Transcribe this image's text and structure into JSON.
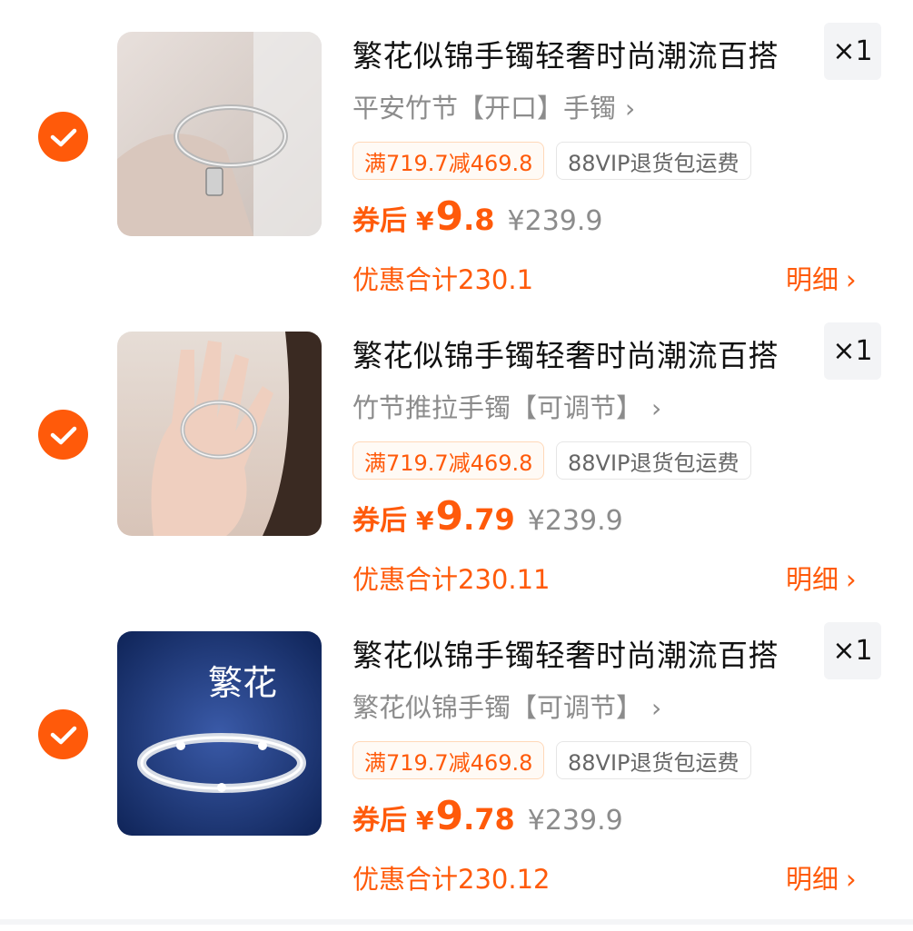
{
  "colors": {
    "accent": "#ff5a0a",
    "muted": "#8c8c8c",
    "text": "#111111"
  },
  "items": [
    {
      "title": "繁花似锦手镯轻奢时尚潮流百搭",
      "qty": "×1",
      "spec": "平安竹节【开口】手镯",
      "promo_tag": "满719.7减469.8",
      "vip_tag": "88VIP退货包运费",
      "after_label": "券后",
      "yen": "¥",
      "price_int": "9",
      "price_dec": ".8",
      "orig_price": "¥239.9",
      "discount": "优惠合计230.1",
      "detail": "明细",
      "image_icon": "bracelet-pendant-photo"
    },
    {
      "title": "繁花似锦手镯轻奢时尚潮流百搭",
      "qty": "×1",
      "spec": "竹节推拉手镯【可调节】",
      "promo_tag": "满719.7减469.8",
      "vip_tag": "88VIP退货包运费",
      "after_label": "券后",
      "yen": "¥",
      "price_int": "9",
      "price_dec": ".79",
      "orig_price": "¥239.9",
      "discount": "优惠合计230.11",
      "detail": "明细",
      "image_icon": "bracelet-hand-photo"
    },
    {
      "title": "繁花似锦手镯轻奢时尚潮流百搭",
      "qty": "×1",
      "spec": "繁花似锦手镯【可调节】",
      "promo_tag": "满719.7减469.8",
      "vip_tag": "88VIP退货包运费",
      "after_label": "券后",
      "yen": "¥",
      "price_int": "9",
      "price_dec": ".78",
      "orig_price": "¥239.9",
      "discount": "优惠合计230.12",
      "detail": "明细",
      "image_icon": "bracelet-product-photo",
      "image_text": "繁花"
    }
  ]
}
